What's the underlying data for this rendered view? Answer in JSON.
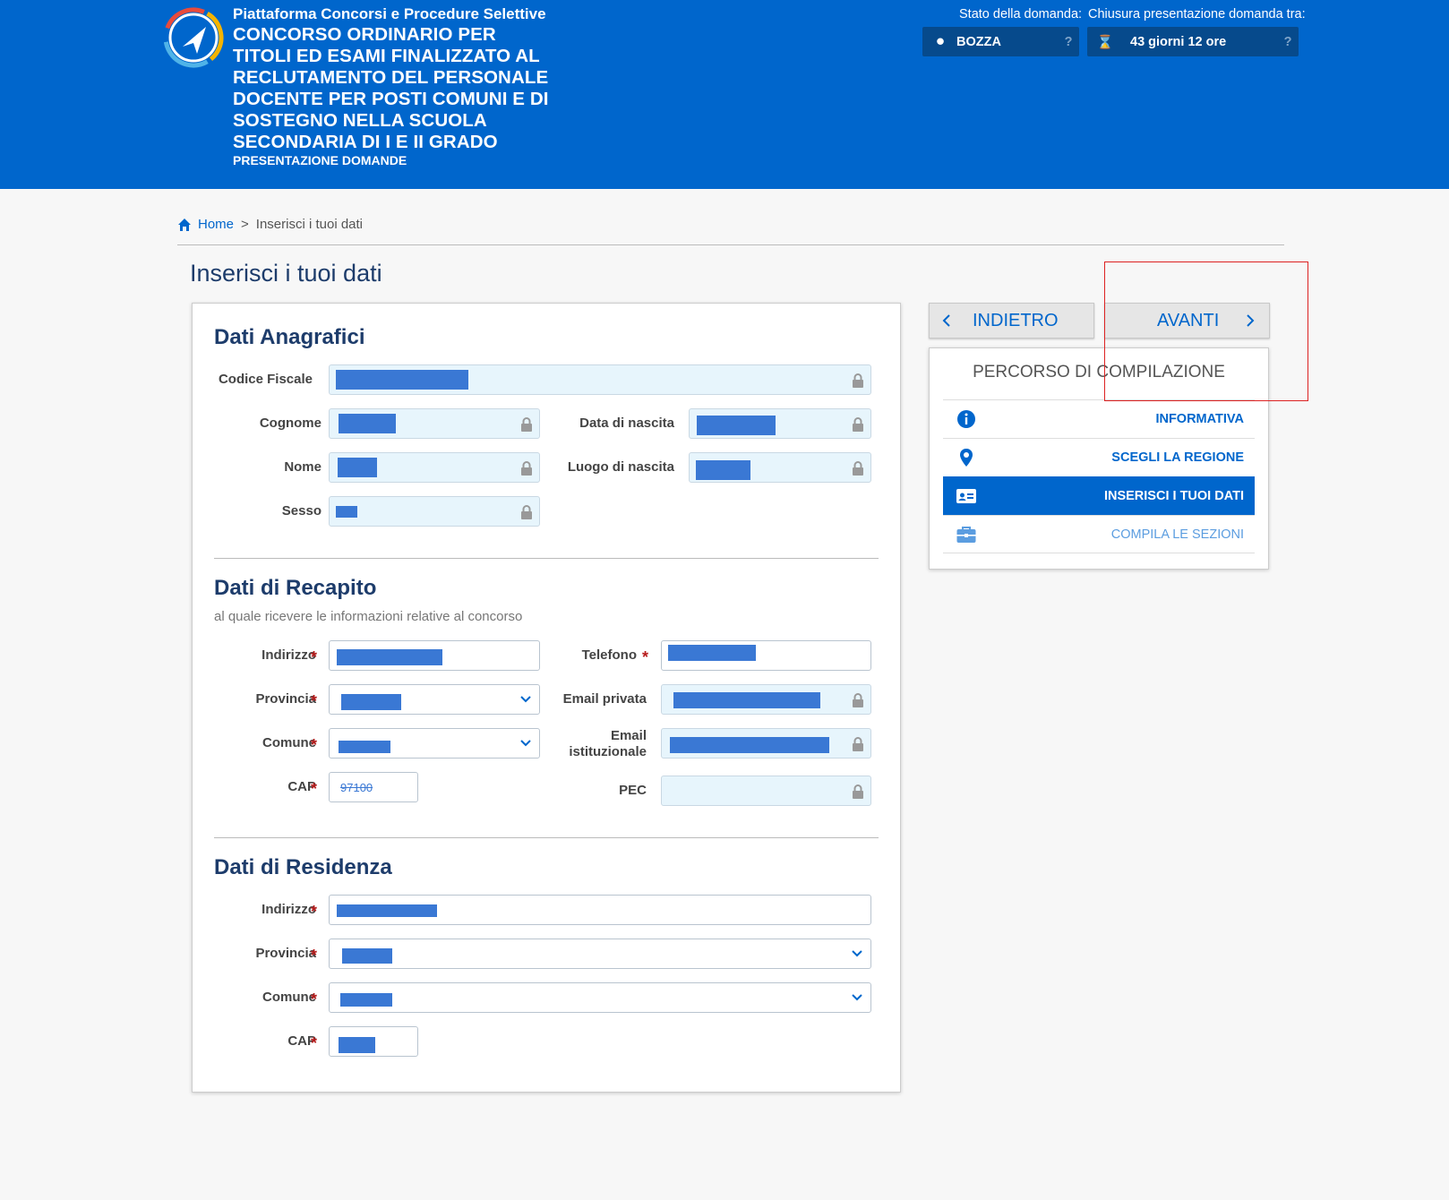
{
  "header": {
    "platform": "Piattaforma Concorsi e Procedure Selettive",
    "title": "CONCORSO ORDINARIO PER TITOLI ED ESAMI FINALIZZATO AL RECLUTAMENTO DEL PERSONALE DOCENTE PER POSTI COMUNI E DI SOSTEGNO NELLA SCUOLA SECONDARIA DI I E II GRADO",
    "subtitle": "PRESENTAZIONE DOMANDE",
    "status_label": "Stato della domanda:",
    "status_value": "BOZZA",
    "deadline_label": "Chiusura presentazione domanda tra:",
    "deadline_value": "43 giorni 12 ore",
    "help_mark": "?",
    "colors": {
      "brand": "#0066cc",
      "status_box": "#064a8c"
    }
  },
  "breadcrumb": {
    "home": "Home",
    "separator": ">",
    "current": "Inserisci i tuoi dati"
  },
  "page_title": "Inserisci i tuoi dati",
  "anagrafici": {
    "title": "Dati Anagrafici",
    "codice_fiscale": "Codice Fiscale",
    "cognome": "Cognome",
    "nome": "Nome",
    "sesso": "Sesso",
    "data_nascita": "Data di nascita",
    "luogo_nascita": "Luogo di nascita"
  },
  "recapito": {
    "title": "Dati di Recapito",
    "subtitle": "al quale ricevere le informazioni relative al concorso",
    "indirizzo": "Indirizzo",
    "provincia": "Provincia",
    "comune": "Comune",
    "cap": "CAP",
    "cap_value": "97100",
    "telefono": "Telefono",
    "email_privata": "Email privata",
    "email_istituzionale": "Email istituzionale",
    "pec": "PEC"
  },
  "residenza": {
    "title": "Dati di Residenza",
    "indirizzo": "Indirizzo",
    "provincia": "Provincia",
    "comune": "Comune",
    "cap": "CAP"
  },
  "required_mark": "*",
  "nav": {
    "back": "INDIETRO",
    "next": "AVANTI"
  },
  "steps": {
    "title": "PERCORSO DI COMPILAZIONE",
    "items": [
      {
        "label": "INFORMATIVA",
        "icon": "info-icon"
      },
      {
        "label": "SCEGLI LA REGIONE",
        "icon": "map-pin-icon"
      },
      {
        "label": "INSERISCI I TUOI DATI",
        "icon": "id-card-icon",
        "active": true
      },
      {
        "label": "COMPILA LE SEZIONI",
        "icon": "briefcase-icon"
      }
    ]
  }
}
